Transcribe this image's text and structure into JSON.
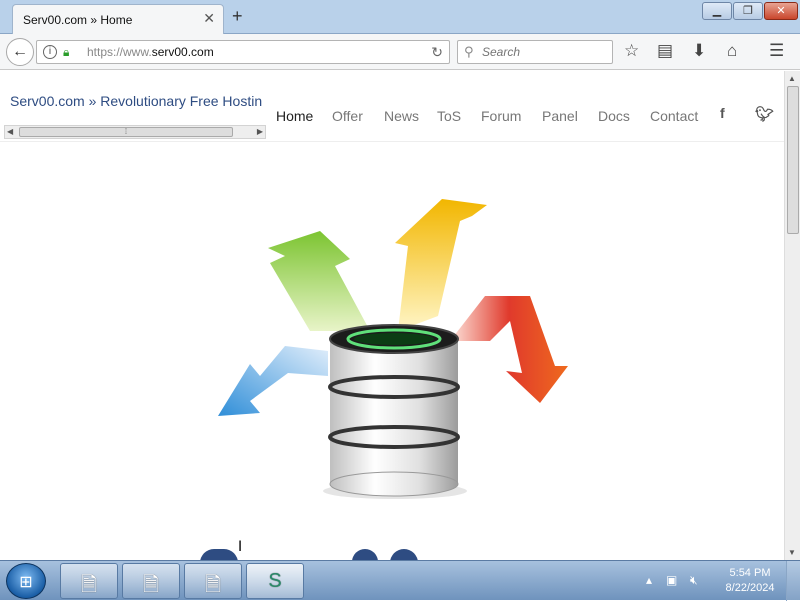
{
  "browser": {
    "tab": {
      "title": "Serv00.com » Home",
      "close_icon": "close-icon"
    },
    "new_tab_icon": "plus-icon",
    "window_controls": {
      "minimize": "minimize-icon",
      "maximize": "maximize-icon",
      "close": "close-icon"
    },
    "url": {
      "prefix": "https://www.",
      "domain": "serv00.com"
    },
    "search": {
      "placeholder": "Search"
    },
    "toolbar_icons": [
      "star-icon",
      "reading-list-icon",
      "download-icon",
      "home-icon",
      "menu-icon"
    ]
  },
  "site": {
    "brand": "Serv00.com » Revolutionary Free Hostin",
    "nav": [
      "Home",
      "Offer",
      "News",
      "ToS",
      "Forum",
      "Panel",
      "Docs",
      "Contact"
    ],
    "active_nav": "Home",
    "social_icons": [
      "facebook-icon",
      "twitter-icon"
    ],
    "hero_image": "server-database-with-arrows"
  },
  "taskbar": {
    "start_icon": "windows-start-icon",
    "tasks": [
      "file-icon",
      "file-icon",
      "file-icon",
      "snake-app-icon"
    ],
    "tray_icons": [
      "tray-arrow-icon",
      "network-icon",
      "volume-muted-icon"
    ],
    "time": "5:54 PM",
    "date": "8/22/2024"
  },
  "colors": {
    "brand_text": "#2e4c82",
    "nav_text": "#777777",
    "active_nav": "#222222"
  }
}
